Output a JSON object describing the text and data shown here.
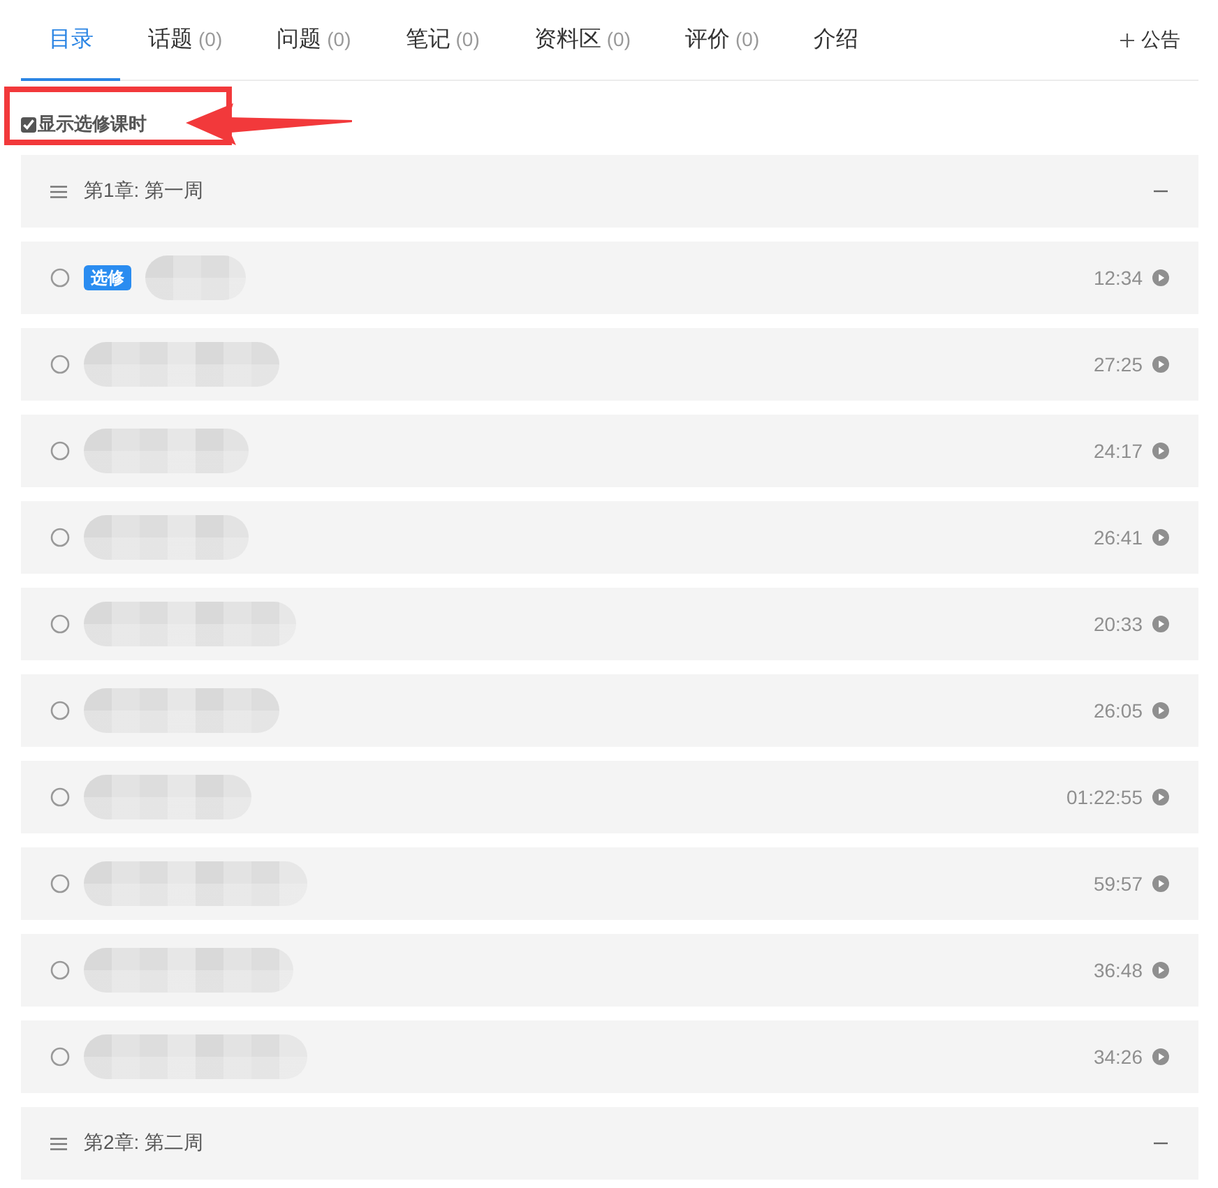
{
  "tabs": [
    {
      "label": "目录",
      "selected": true
    },
    {
      "label": "话题",
      "count": "(0)",
      "selected": false
    },
    {
      "label": "问题",
      "count": "(0)",
      "selected": false
    },
    {
      "label": "笔记",
      "count": "(0)",
      "selected": false
    },
    {
      "label": "资料区",
      "count": "(0)",
      "selected": false
    },
    {
      "label": "评价",
      "count": "(0)",
      "selected": false
    },
    {
      "label": "介绍",
      "selected": false
    }
  ],
  "announcement_button": {
    "label": "公告"
  },
  "show_optional": {
    "label": "显示选修课时",
    "checked": true
  },
  "chapters": [
    {
      "title": "第1章: 第一周",
      "expanded": true,
      "lessons": [
        {
          "tag": "选修",
          "duration": "12:34"
        },
        {
          "duration": "27:25"
        },
        {
          "duration": "24:17"
        },
        {
          "duration": "26:41"
        },
        {
          "duration": "20:33"
        },
        {
          "duration": "26:05"
        },
        {
          "duration": "01:22:55"
        },
        {
          "duration": "59:57"
        },
        {
          "duration": "36:48"
        },
        {
          "duration": "34:26"
        }
      ]
    },
    {
      "title": "第2章: 第二周",
      "expanded": true
    }
  ]
}
